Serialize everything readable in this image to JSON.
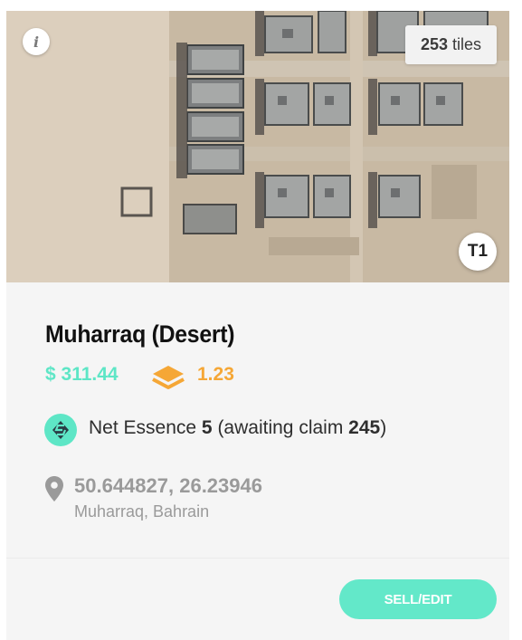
{
  "map": {
    "info_label": "i",
    "tiles_count": "253",
    "tiles_unit": "tiles",
    "tier": "T1"
  },
  "property": {
    "title": "Muharraq (Desert)",
    "price": "$ 311.44",
    "layers_value": "1.23",
    "essence_prefix": "Net Essence",
    "essence_value": "5",
    "essence_mid": "(awaiting claim",
    "essence_claim": "245",
    "essence_suffix": ")",
    "coordinates": "50.644827, 26.23946",
    "location": "Muharraq, Bahrain"
  },
  "actions": {
    "sell_label": "SELL/EDIT"
  },
  "colors": {
    "price": "#5ee6c6",
    "layers": "#f5a736",
    "essence_icon_bg": "#5ee6c6",
    "button": "#63e8c9",
    "muted": "#9a9a9a"
  },
  "icons": {
    "info": "info-icon",
    "layers": "layers-icon",
    "essence": "essence-icon",
    "location": "map-pin-icon"
  }
}
